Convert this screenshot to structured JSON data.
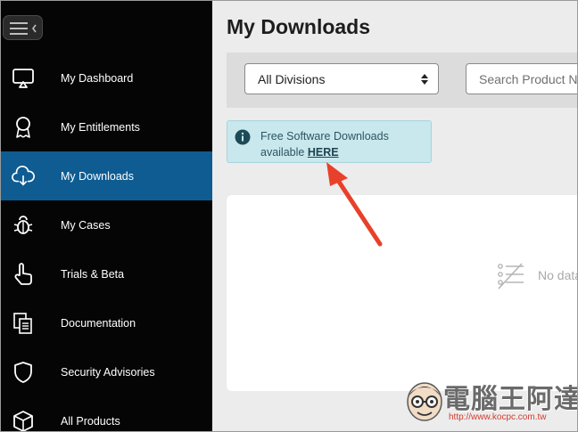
{
  "sidebar": {
    "items": [
      {
        "label": "My Dashboard",
        "icon": "monitor-icon"
      },
      {
        "label": "My Entitlements",
        "icon": "award-ribbon-icon"
      },
      {
        "label": "My Downloads",
        "icon": "cloud-download-icon",
        "active": true
      },
      {
        "label": "My Cases",
        "icon": "bug-icon"
      },
      {
        "label": "Trials & Beta",
        "icon": "pointer-hand-icon"
      },
      {
        "label": "Documentation",
        "icon": "documents-icon"
      },
      {
        "label": "Security Advisories",
        "icon": "shield-icon"
      },
      {
        "label": "All Products",
        "icon": "cube-icon"
      }
    ]
  },
  "main": {
    "title": "My Downloads",
    "filter": {
      "division_selected": "All Divisions",
      "search_placeholder": "Search Product Name"
    },
    "notice": {
      "text": "Free Software Downloads available ",
      "link_text": "HERE"
    },
    "empty_state": {
      "text": "No data"
    }
  },
  "watermark": {
    "text": "電腦王阿達",
    "url": "http://www.kocpc.com.tw"
  },
  "colors": {
    "sidebar_bg": "#050505",
    "active_item": "#0e5c92",
    "notice_bg": "#c8e8ed",
    "annotation_arrow": "#e8402a"
  }
}
